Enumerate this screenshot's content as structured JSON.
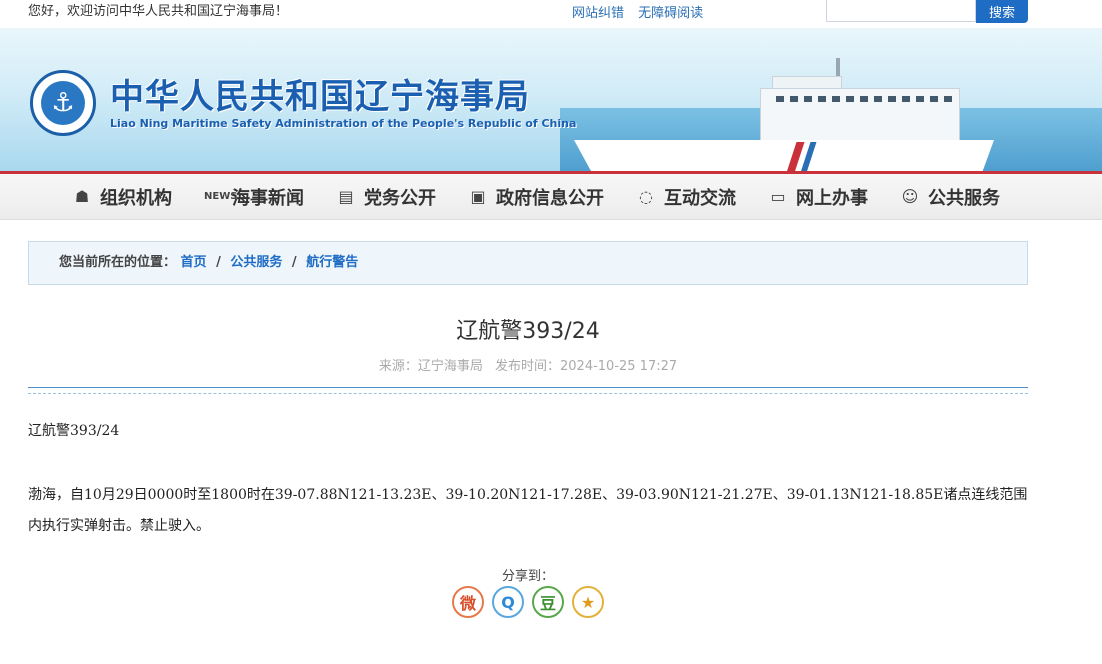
{
  "topbar": {
    "welcome": "您好，欢迎访问中华人民共和国辽宁海事局！",
    "links": [
      "网站纠错",
      "无障碍阅读"
    ],
    "search_value": "",
    "search_button": "搜索"
  },
  "banner": {
    "logo_icon": "anchor-icon",
    "title": "中华人民共和国辽宁海事局",
    "subtitle": "Liao Ning Maritime Safety Administration of the People's Republic of China"
  },
  "nav": {
    "items": [
      {
        "label": "组织机构",
        "icon": "org-chart-icon"
      },
      {
        "label": "海事新闻",
        "icon": "news-icon"
      },
      {
        "label": "党务公开",
        "icon": "book-icon"
      },
      {
        "label": "政府信息公开",
        "icon": "document-icon"
      },
      {
        "label": "互动交流",
        "icon": "chat-icon"
      },
      {
        "label": "网上办事",
        "icon": "monitor-icon"
      },
      {
        "label": "公共服务",
        "icon": "service-icon"
      }
    ]
  },
  "breadcrumb": {
    "prefix": "您当前所在的位置：",
    "items": [
      "首页",
      "公共服务",
      "航行警告"
    ],
    "separator": "/"
  },
  "article": {
    "title": "辽航警393/24",
    "source": "来源：辽宁海事局",
    "published": "发布时间：2024-10-25 17:27",
    "paragraphs": [
      "辽航警393/24",
      "渤海，自10月29日0000时至1800时在39-07.88N121-13.23E、39-10.20N121-17.28E、39-03.90N121-21.27E、39-01.13N121-18.85E诸点连线范围内执行实弹射击。禁止驶入。"
    ]
  },
  "share": {
    "label": "分享到：",
    "buttons": [
      {
        "name": "weibo",
        "icon": "weibo-icon",
        "glyph": "微"
      },
      {
        "name": "qq",
        "icon": "qq-icon",
        "glyph": "Q"
      },
      {
        "name": "douban",
        "icon": "douban-icon",
        "glyph": "豆"
      },
      {
        "name": "favorite",
        "icon": "star-icon",
        "glyph": "★"
      }
    ]
  },
  "colors": {
    "brand_blue": "#1b5fb0",
    "accent_red": "#c9323a",
    "link_blue": "#1f6cc4"
  }
}
